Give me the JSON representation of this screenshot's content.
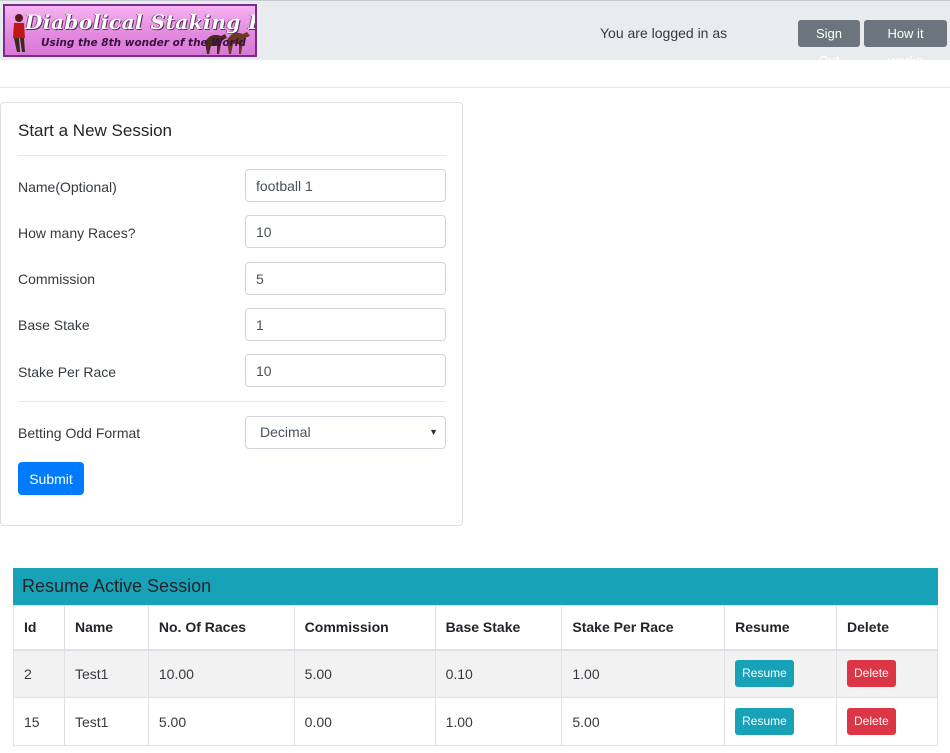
{
  "header": {
    "logo_title": "Diabolical Staking Plan",
    "logo_subtitle": "Using the 8th wonder of the World",
    "logged_in_text": "You are logged in as",
    "sign_out_label": "Sign Out",
    "how_it_works_label": "How it works"
  },
  "form": {
    "title": "Start a New Session",
    "name_label": "Name(Optional)",
    "name_value": "football 1",
    "races_label": "How many Races?",
    "races_value": "10",
    "commission_label": "Commission",
    "commission_value": "5",
    "base_stake_label": "Base Stake",
    "base_stake_value": "1",
    "stake_per_race_label": "Stake Per Race",
    "stake_per_race_value": "10",
    "odds_format_label": "Betting Odd Format",
    "odds_format_value": "Decimal",
    "submit_label": "Submit"
  },
  "sessions": {
    "title": "Resume Active Session",
    "columns": [
      "Id",
      "Name",
      "No. Of Races",
      "Commission",
      "Base Stake",
      "Stake Per Race",
      "Resume",
      "Delete"
    ],
    "rows": [
      {
        "id": "2",
        "name": "Test1",
        "races": "10.00",
        "commission": "5.00",
        "base_stake": "0.10",
        "stake_per_race": "1.00",
        "resume_label": "Resume",
        "delete_label": "Delete"
      },
      {
        "id": "15",
        "name": "Test1",
        "races": "5.00",
        "commission": "0.00",
        "base_stake": "1.00",
        "stake_per_race": "5.00",
        "resume_label": "Resume",
        "delete_label": "Delete"
      }
    ]
  },
  "colors": {
    "primary": "#007bff",
    "info": "#17a2b8",
    "danger": "#dc3545",
    "secondary": "#6c757d"
  }
}
